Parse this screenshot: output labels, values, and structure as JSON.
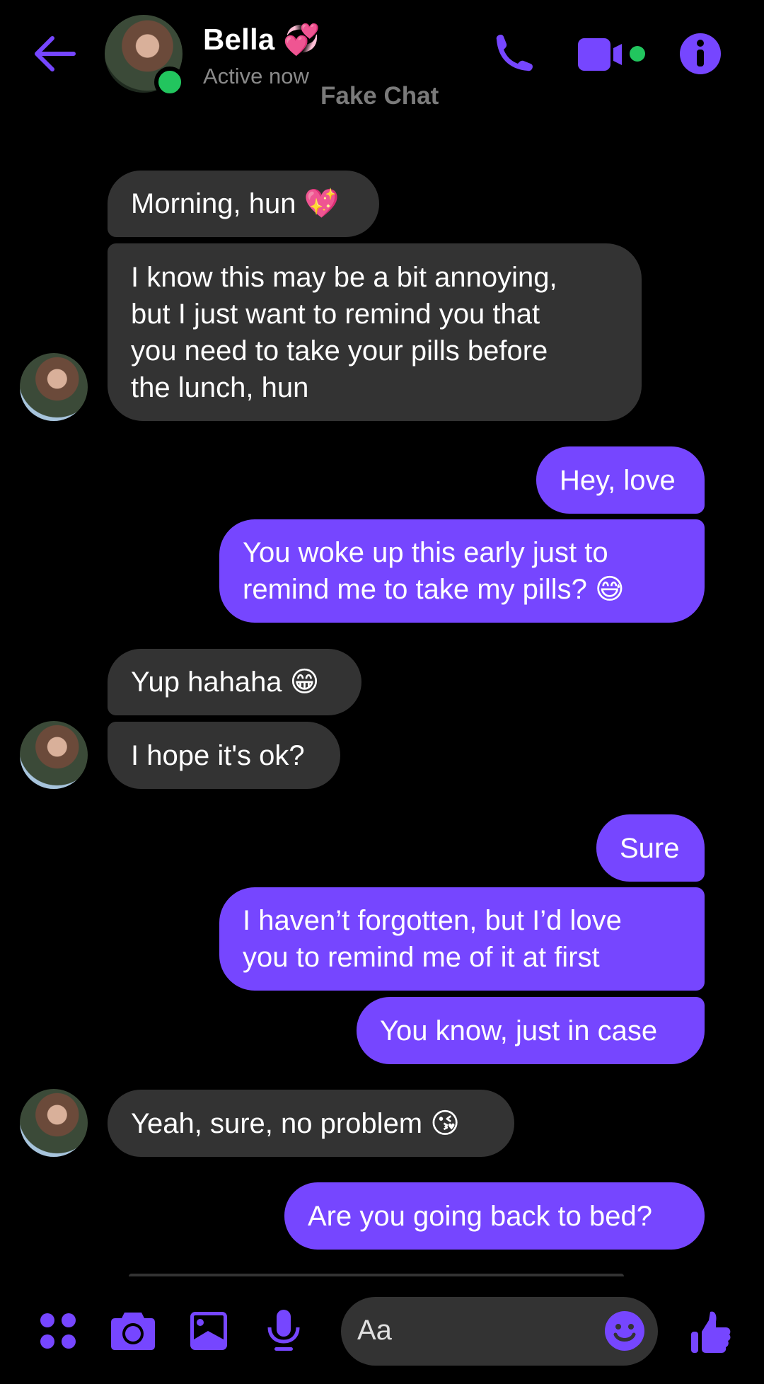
{
  "header": {
    "contact_name": "Bella",
    "name_emoji": "💞",
    "status": "Active now",
    "watermark": "Fake Chat",
    "icons": [
      "back-arrow-icon",
      "phone-icon",
      "video-camera-icon",
      "info-icon"
    ],
    "accent_color": "#7646ff",
    "online_color": "#22c55e"
  },
  "messages": [
    {
      "sender": "Bella",
      "direction": "incoming",
      "text": "Morning, hun 💖"
    },
    {
      "sender": "Bella",
      "direction": "incoming",
      "text": "I know this may be a bit annoying,\nbut I just want to remind you that\nyou need to take your pills before\nthe lunch, hun"
    },
    {
      "sender": "me",
      "direction": "outgoing",
      "text": "Hey, love"
    },
    {
      "sender": "me",
      "direction": "outgoing",
      "text": "You woke up this early just to\nremind me to take my pills? 😅"
    },
    {
      "sender": "Bella",
      "direction": "incoming",
      "text": "Yup hahaha 😁"
    },
    {
      "sender": "Bella",
      "direction": "incoming",
      "text": "I hope it's ok?"
    },
    {
      "sender": "me",
      "direction": "outgoing",
      "text": "Sure"
    },
    {
      "sender": "me",
      "direction": "outgoing",
      "text": "I haven’t forgotten, but I’d love\nyou to remind me of it at first"
    },
    {
      "sender": "me",
      "direction": "outgoing",
      "text": "You know, just in case"
    },
    {
      "sender": "Bella",
      "direction": "incoming",
      "text": "Yeah, sure, no problem 😘"
    },
    {
      "sender": "me",
      "direction": "outgoing",
      "text": "Are you going back to bed?"
    }
  ],
  "composer": {
    "placeholder": "Aa",
    "icons": [
      "apps-grid-icon",
      "camera-icon",
      "gallery-icon",
      "microphone-icon",
      "emoji-icon",
      "thumbs-up-icon"
    ]
  },
  "colors": {
    "incoming_bubble": "#333333",
    "outgoing_bubble": "#7646ff",
    "background": "#000000"
  }
}
